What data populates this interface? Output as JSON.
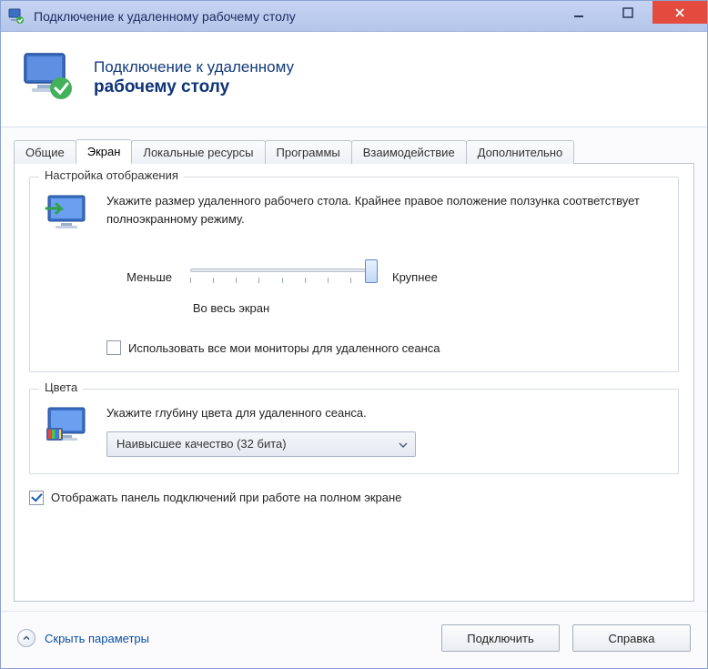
{
  "window": {
    "title": "Подключение к удаленному рабочему столу"
  },
  "header": {
    "line1": "Подключение к удаленному",
    "line2": "рабочему столу"
  },
  "tabs": [
    {
      "label": "Общие",
      "active": false
    },
    {
      "label": "Экран",
      "active": true
    },
    {
      "label": "Локальные ресурсы",
      "active": false
    },
    {
      "label": "Программы",
      "active": false
    },
    {
      "label": "Взаимодействие",
      "active": false
    },
    {
      "label": "Дополнительно",
      "active": false
    }
  ],
  "display_group": {
    "legend": "Настройка отображения",
    "description": "Укажите размер удаленного рабочего стола. Крайнее правое положение ползунка соответствует полноэкранному режиму.",
    "slider": {
      "min_label": "Меньше",
      "max_label": "Крупнее",
      "value_caption": "Во весь экран"
    },
    "use_all_monitors": {
      "label": "Использовать все мои мониторы для удаленного сеанса",
      "checked": false
    }
  },
  "colors_group": {
    "legend": "Цвета",
    "description": "Укажите глубину цвета для удаленного сеанса.",
    "selected": "Наивысшее качество (32 бита)"
  },
  "show_connection_bar": {
    "label": "Отображать панель подключений при работе на полном экране",
    "checked": true
  },
  "footer": {
    "toggle_label": "Скрыть параметры",
    "connect": "Подключить",
    "help": "Справка"
  }
}
